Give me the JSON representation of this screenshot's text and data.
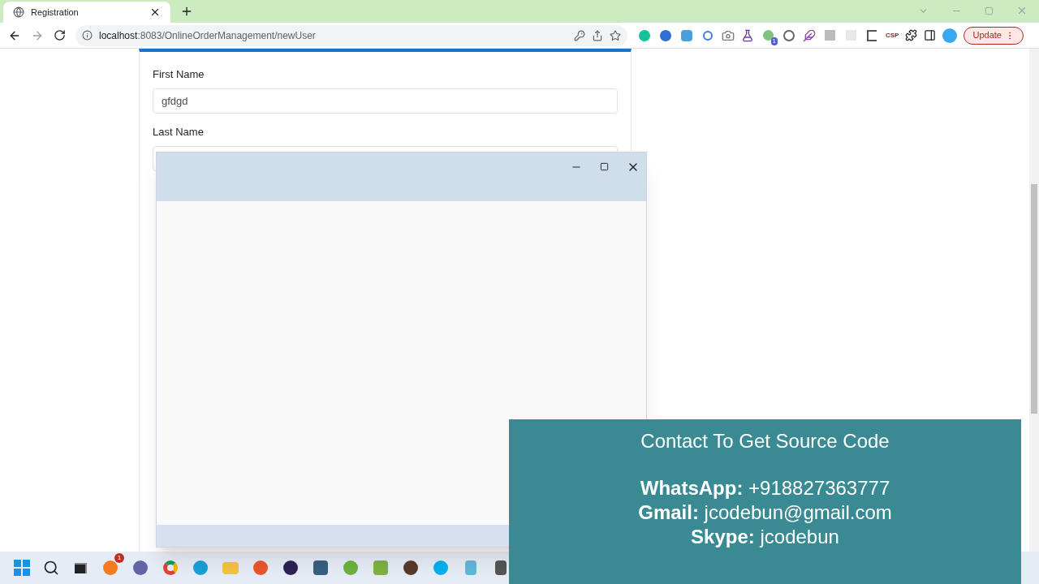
{
  "browser": {
    "tabs": [
      {
        "title": "Registration",
        "selected": true
      }
    ],
    "url": {
      "host": "localhost",
      "path": ":8083/OnlineOrderManagement/newUser"
    },
    "extension_badge": "1",
    "csp_label": "CSP",
    "update_button": "Update"
  },
  "form": {
    "fields": [
      {
        "label": "First Name",
        "value": "gfdgd"
      },
      {
        "label": "Last Name"
      }
    ]
  },
  "contact_banner": {
    "title": "Contact To Get Source Code",
    "lines": [
      "**WhatsApp:** +918827363777",
      "**Gmail:** jcodebun@gmail.com",
      "**Skype:** jcodebun"
    ]
  },
  "taskbar": {
    "notification_badge": "1"
  }
}
